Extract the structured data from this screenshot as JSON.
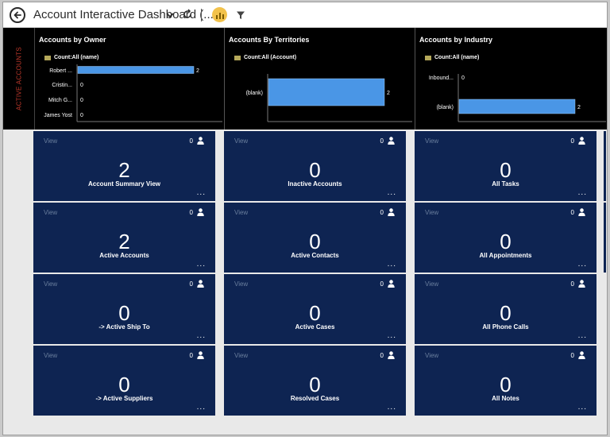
{
  "header": {
    "title": "Account Interactive Dashboard (...",
    "icons": {
      "back": "back-arrow-icon",
      "dropdown": "chevron-down-icon",
      "refresh": "refresh-icon",
      "chart": "chart-icon",
      "filter": "filter-icon"
    }
  },
  "side_label": "ACTIVE ACCOUNTS",
  "charts": [
    {
      "title": "Accounts by Owner",
      "legend": "Count:All (name)",
      "chart_data": {
        "type": "bar",
        "orientation": "horizontal",
        "categories": [
          "Robert ...",
          "Cristin...",
          "Mitch G...",
          "James Yost"
        ],
        "values": [
          2,
          0,
          0,
          0
        ],
        "value_labels": [
          "2",
          "0",
          "0",
          "0"
        ]
      }
    },
    {
      "title": "Accounts By Territories",
      "legend": "Count:All (Account)",
      "chart_data": {
        "type": "bar",
        "orientation": "horizontal",
        "categories": [
          "(blank)"
        ],
        "values": [
          2
        ],
        "value_labels": [
          "2"
        ]
      }
    },
    {
      "title": "Accounts by Industry",
      "legend": "Count:All (name)",
      "chart_data": {
        "type": "bar",
        "orientation": "horizontal",
        "categories": [
          "Inbound...",
          "(blank)"
        ],
        "values": [
          0,
          2
        ],
        "value_labels": [
          "0",
          "2"
        ]
      }
    }
  ],
  "colors": {
    "bar": "#4a96e6",
    "tile": "#0e2452",
    "legend": "#b5a85a"
  },
  "tiles": [
    {
      "view": "View",
      "count": "0",
      "big": "2",
      "name": "Account Summary View",
      "more": "..."
    },
    {
      "view": "View",
      "count": "0",
      "big": "0",
      "name": "Inactive Accounts",
      "more": "..."
    },
    {
      "view": "View",
      "count": "0",
      "big": "0",
      "name": "All Tasks",
      "more": "..."
    },
    {
      "view": "View",
      "count": "0",
      "big": "2",
      "name": "Active Accounts",
      "more": "..."
    },
    {
      "view": "View",
      "count": "0",
      "big": "0",
      "name": "Active Contacts",
      "more": "..."
    },
    {
      "view": "View",
      "count": "0",
      "big": "0",
      "name": "All Appointments",
      "more": "..."
    },
    {
      "view": "View",
      "count": "0",
      "big": "0",
      "name": "-> Active Ship To",
      "more": "..."
    },
    {
      "view": "View",
      "count": "0",
      "big": "0",
      "name": "Active Cases",
      "more": "..."
    },
    {
      "view": "View",
      "count": "0",
      "big": "0",
      "name": "All Phone Calls",
      "more": "..."
    },
    {
      "view": "View",
      "count": "0",
      "big": "0",
      "name": "-> Active Suppliers",
      "more": "..."
    },
    {
      "view": "View",
      "count": "0",
      "big": "0",
      "name": "Resolved Cases",
      "more": "..."
    },
    {
      "view": "View",
      "count": "0",
      "big": "0",
      "name": "All Notes",
      "more": "..."
    }
  ]
}
